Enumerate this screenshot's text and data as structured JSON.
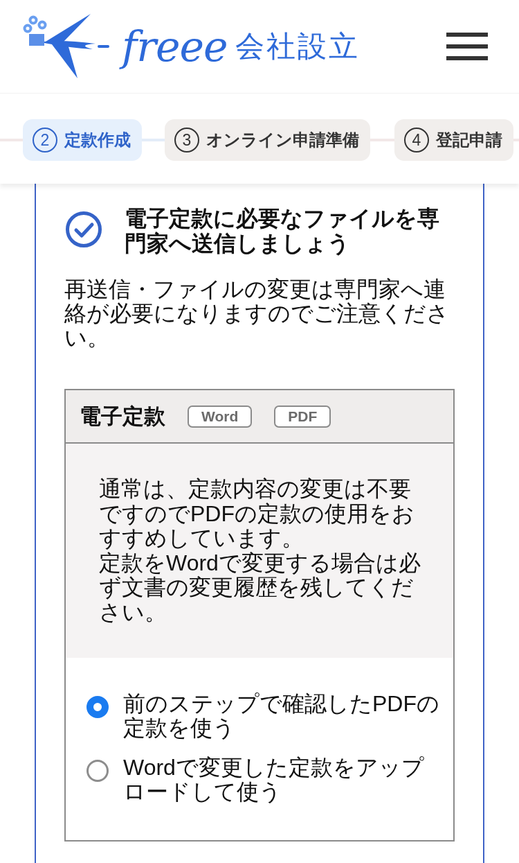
{
  "header": {
    "wordmark": "freee",
    "title": "会社設立"
  },
  "steps": [
    {
      "number": "2",
      "label": "定款作成",
      "selected": true
    },
    {
      "number": "3",
      "label": "オンライン申請準備",
      "selected": false
    },
    {
      "number": "4",
      "label": "登記申請",
      "selected": false
    }
  ],
  "task": {
    "title": "電子定款に必要なファイルを専門家へ送信しましょう",
    "note": "再送信・ファイルの変更は専門家へ連絡が必要になりますのでご注意ください。"
  },
  "articles_panel": {
    "title": "電子定款",
    "formats": [
      "Word",
      "PDF"
    ],
    "notice": [
      "通常は、定款内容の変更は不要ですのでPDFの定款の使用をおすすめしています。",
      "定款をWordで変更する場合は必ず文書の変更履歴を残してください。"
    ],
    "options": [
      {
        "label": "前のステップで確認したPDFの定款を使う",
        "selected": true
      },
      {
        "label": "Wordで変更した定款をアップロードして使う",
        "selected": false
      }
    ]
  }
}
